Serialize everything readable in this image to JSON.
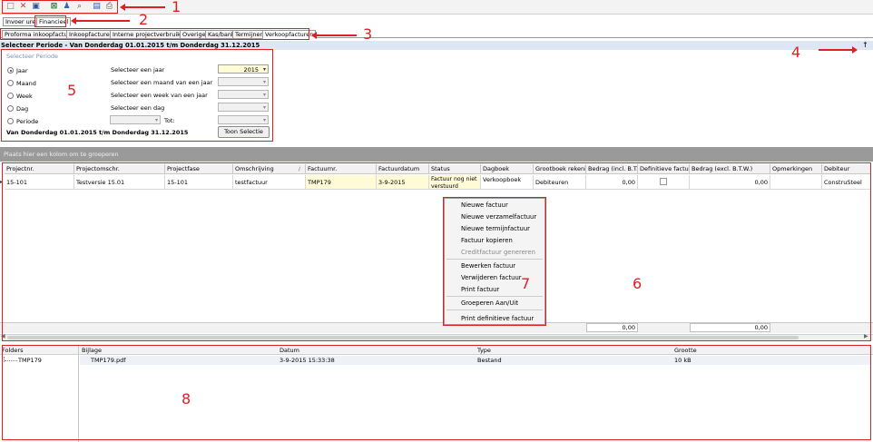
{
  "toolbar": {
    "icons": [
      "new-document-icon",
      "delete-icon",
      "save-icon",
      "excel-export-icon",
      "users-icon",
      "search-icon",
      "page-icon",
      "print-icon"
    ]
  },
  "upper_tabs": [
    "Invoer uren",
    "Financieel"
  ],
  "module_tabs": [
    "Proforma inkoopfactuur",
    "Inkoopfacturen",
    "Interne projectverbruiken",
    "Overige",
    "Kas/bank",
    "Termijnen",
    "Verkoopfacturen"
  ],
  "header": {
    "title": "Selecteer Periode - Van Donderdag 01.01.2015 t/m Donderdag 31.12.2015",
    "pin": "↑"
  },
  "filter": {
    "legend": "Selecteer Periode",
    "radios": [
      "Jaar",
      "Maand",
      "Week",
      "Dag",
      "Periode"
    ],
    "selected": "Jaar",
    "prompts": [
      "Selecteer een jaar",
      "Selecteer een maand van een jaar",
      "Selecteer een week van een jaar",
      "Selecteer een dag"
    ],
    "year_value": "2015",
    "tot_label": "Tot:",
    "range_text": "Van Donderdag 01.01.2015 t/m Donderdag 31.12.2015",
    "show_button": "Toon Selectie"
  },
  "group_hint": "Plaats hier een kolom om te groeperen",
  "grid": {
    "columns": [
      "Projectnr.",
      "Projectomschr.",
      "Projectfase",
      "Omschrijving",
      "Factuurnr.",
      "Factuurdatum",
      "Status",
      "Dagboek",
      "Grootboek rekening",
      "Bedrag (incl. B.T.W)",
      "Definitieve factuur",
      "Bedrag (excl. B.T.W.)",
      "Opmerkingen",
      "Debiteur"
    ],
    "row": {
      "projectnr": "15-101",
      "projectomschr": "Testversie 15.01",
      "projectfase": "15-101",
      "omschrijving": "testfactuur",
      "factuurnr": "TMP179",
      "factuurdatum": "3-9-2015",
      "status": "Factuur nog niet verstuurd",
      "dagboek": "Verkoopboek",
      "grootboek": "Debiteuren",
      "bedrag_incl": "0,00",
      "definitief": false,
      "bedrag_excl": "0,00",
      "opmerkingen": "",
      "debiteur": "ConstruSteel"
    },
    "totals": {
      "incl": "0,00",
      "excl": "0,00"
    }
  },
  "context_menu": {
    "items": [
      {
        "label": "Nieuwe factuur",
        "enabled": true
      },
      {
        "label": "Nieuwe verzamelfactuur",
        "enabled": true
      },
      {
        "label": "Nieuwe termijnfactuur",
        "enabled": true
      },
      {
        "label": "Factuur kopieren",
        "enabled": true
      },
      {
        "label": "Creditfactuur genereren",
        "enabled": false
      },
      {
        "label": "Bewerken factuur",
        "enabled": true
      },
      {
        "label": "Verwijderen factuur",
        "enabled": true
      },
      {
        "label": "Print factuur",
        "enabled": true
      },
      {
        "label": "Groeperen Aan/Uit",
        "enabled": true
      },
      {
        "label": "Print definitieve factuur",
        "enabled": true
      }
    ]
  },
  "attachments": {
    "columns": [
      "Folders",
      "Bijlage",
      "Datum",
      "Type",
      "Grootte"
    ],
    "folder": "TMP179",
    "row": {
      "bijlage": "TMP179.pdf",
      "datum": "3-9-2015 15:33:38",
      "type": "Bestand",
      "grootte": "10 kB"
    }
  },
  "annotations": [
    "1",
    "2",
    "3",
    "4",
    "5",
    "6",
    "7",
    "8"
  ],
  "colors": {
    "annotation": "#e02020",
    "header_bg": "#dce6f4",
    "highlight": "#fffbd6",
    "group_bar": "#9a9a9a"
  }
}
